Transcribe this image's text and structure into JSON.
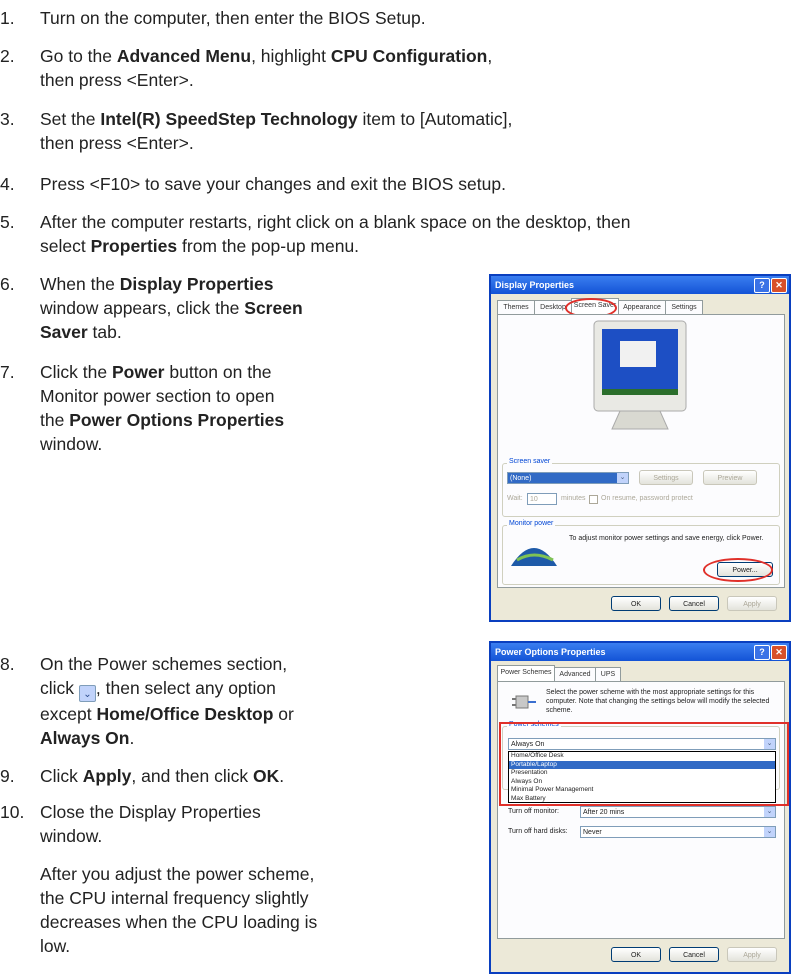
{
  "steps": [
    {
      "n": "1.",
      "text": "Turn on the computer, then enter the BIOS Setup."
    },
    {
      "n": "2.",
      "a": "Go to the ",
      "b": "Advanced Menu",
      "c": ", highlight ",
      "d": "CPU Configuration",
      "e": ",",
      "line2": "then press <Enter>."
    },
    {
      "n": "3.",
      "a": "Set the ",
      "b": "Intel(R) SpeedStep Technology",
      "c": " item to [Automatic],",
      "line2": "then press <Enter>."
    },
    {
      "n": "4.",
      "text": "Press <F10> to save your changes and exit the BIOS setup."
    },
    {
      "n": "5.",
      "line1": "After the computer restarts, right click on a blank space on the desktop, then",
      "a": "select ",
      "b": "Properties",
      "c": " from the pop-up menu."
    },
    {
      "n": "6.",
      "a": "When the ",
      "b": "Display Properties",
      "line2a": "window appears, click the ",
      "line2b": "Screen",
      "line3a": "Saver",
      "line3b": " tab."
    },
    {
      "n": "7.",
      "a": "Click the ",
      "b": "Power",
      "c": " button on the",
      "line2": "Monitor power section to open",
      "line3a": "the ",
      "line3b": "Power Options Properties",
      "line4": "window."
    },
    {
      "n": "8.",
      "line1": "On the Power schemes section,",
      "l2a": "click ",
      "l2b": ", then select any option",
      "l3a": "except ",
      "l3b": "Home/Office Desktop",
      "l3c": " or",
      "l4a": "Always On",
      "l4b": "."
    },
    {
      "n": "9.",
      "a": "Click ",
      "b": "Apply",
      "c": ", and then click ",
      "d": "OK",
      "e": "."
    },
    {
      "n": "10.",
      "line1": "Close the Display Properties",
      "line2": "window."
    }
  ],
  "note": {
    "lines": [
      "After you adjust the power scheme,",
      "the CPU internal frequency slightly",
      "decreases when the CPU loading is",
      "low."
    ]
  },
  "display_window": {
    "title": "Display Properties",
    "tabs": [
      "Themes",
      "Desktop",
      "Screen Saver",
      "Appearance",
      "Settings"
    ],
    "screensaver_group": "Screen saver",
    "screensaver_value": "(None)",
    "settings_btn": "Settings",
    "preview_btn": "Preview",
    "wait_label": "Wait:",
    "wait_value": "10",
    "minutes_label": "minutes",
    "resume_label": "On resume, password protect",
    "monitor_group": "Monitor power",
    "monitor_text": "To adjust monitor power settings and save energy, click Power.",
    "power_btn": "Power...",
    "ok_btn": "OK",
    "cancel_btn": "Cancel",
    "apply_btn": "Apply"
  },
  "power_window": {
    "title": "Power Options Properties",
    "tabs": [
      "Power Schemes",
      "Advanced",
      "UPS"
    ],
    "intro": "Select the power scheme with the most appropriate settings for this computer. Note that changing the settings below will modify the selected scheme.",
    "schemes_group": "Power schemes",
    "selected": "Always On",
    "options": [
      "Home/Office Desk",
      "Portable/Laptop",
      "Presentation",
      "Always On",
      "Minimal Power Management",
      "Max Battery"
    ],
    "turn_off_monitor_label": "Turn off monitor:",
    "turn_off_monitor_value": "After 20 mins",
    "turn_off_disks_label": "Turn off hard disks:",
    "turn_off_disks_value": "Never",
    "ok_btn": "OK",
    "cancel_btn": "Cancel",
    "apply_btn": "Apply"
  }
}
